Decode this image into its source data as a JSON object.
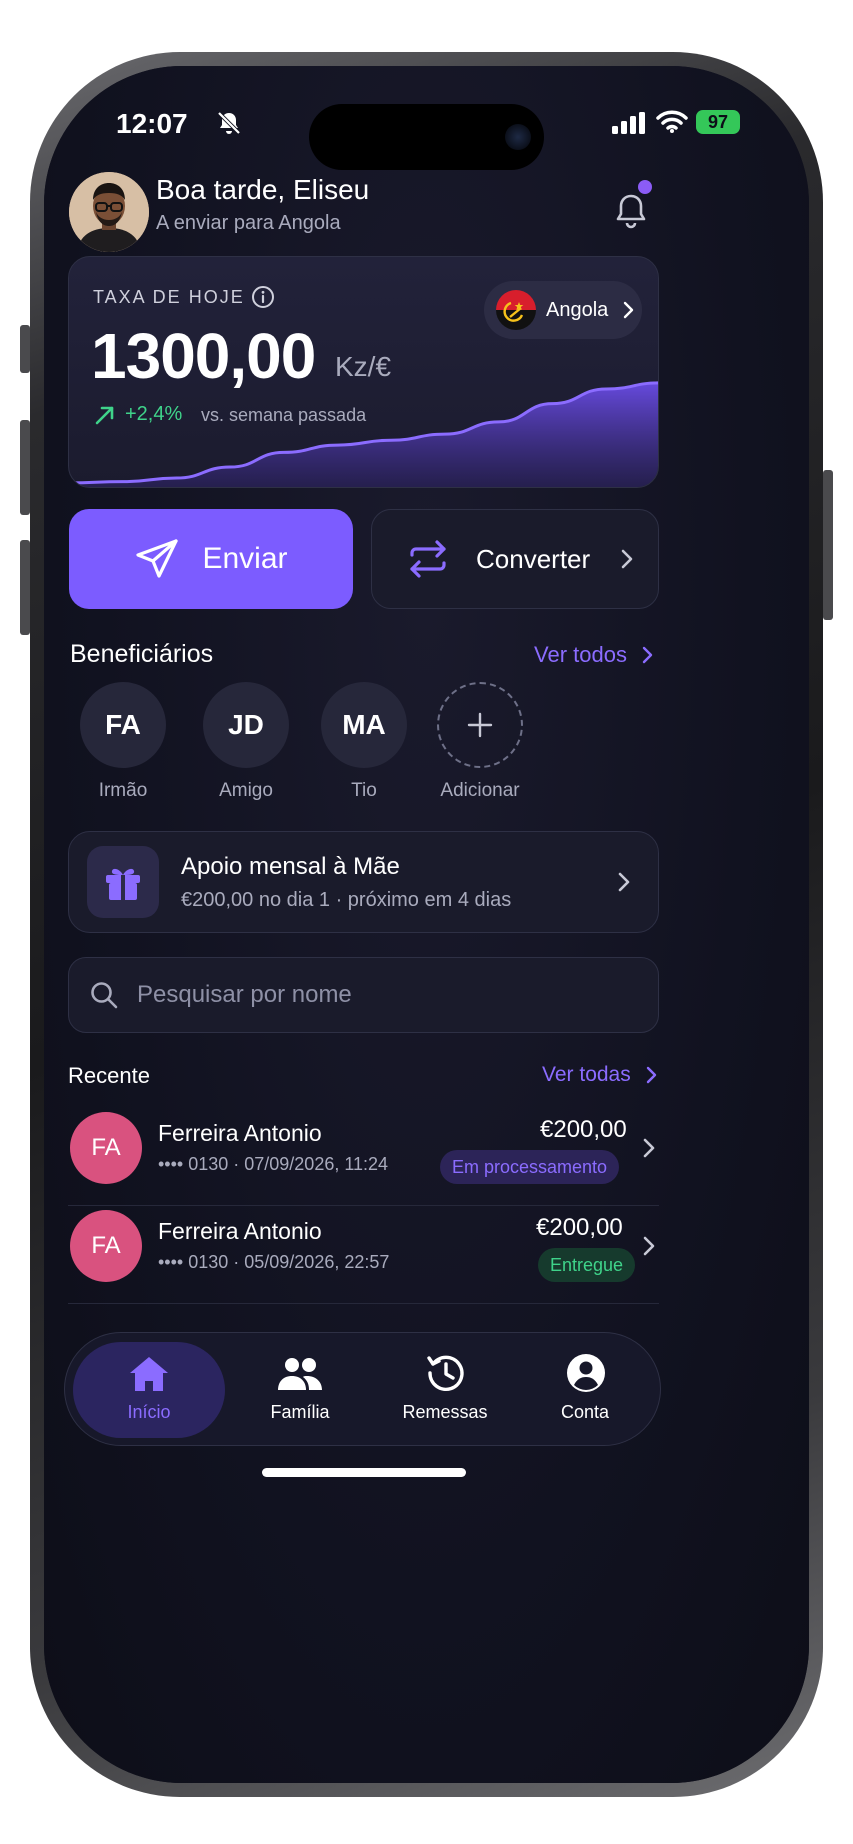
{
  "status_bar": {
    "time": "12:07",
    "battery": "97"
  },
  "header": {
    "greeting": "Boa tarde, Eliseu",
    "subtitle": "A enviar para Angola"
  },
  "rate_card": {
    "label": "TAXA DE HOJE",
    "value": "1300,00",
    "unit": "Kz/€",
    "change": "+2,4%",
    "change_caption": "vs. semana passada",
    "country": "Angola",
    "trend": [
      0.05,
      0.06,
      0.09,
      0.18,
      0.3,
      0.36,
      0.4,
      0.45,
      0.55,
      0.7,
      0.82,
      0.87
    ]
  },
  "actions": {
    "send_label": "Enviar",
    "convert_label": "Converter"
  },
  "beneficiaries": {
    "title": "Beneficiários",
    "view_all": "Ver todos",
    "items": [
      {
        "initials": "FA",
        "label": "Irmão"
      },
      {
        "initials": "JD",
        "label": "Amigo"
      },
      {
        "initials": "MA",
        "label": "Tio"
      }
    ],
    "add_label": "Adicionar"
  },
  "recurring": {
    "title": "Apoio mensal à Mãe",
    "subtitle": "€200,00 no dia 1 · próximo em 4 dias"
  },
  "search": {
    "placeholder": "Pesquisar por nome"
  },
  "recent": {
    "title": "Recente",
    "view_all": "Ver todas",
    "items": [
      {
        "initials": "FA",
        "name": "Ferreira Antonio",
        "meta": "•••• 0130 · 07/09/2026, 11:24",
        "amount": "€200,00",
        "status": "Em processamento",
        "status_color": "#8b6cff",
        "status_bg": "#2c2458"
      },
      {
        "initials": "FA",
        "name": "Ferreira Antonio",
        "meta": "•••• 0130 · 05/09/2026, 22:57",
        "amount": "€200,00",
        "status": "Entregue",
        "status_color": "#3fd38a",
        "status_bg": "#163a2d"
      }
    ]
  },
  "nav": {
    "home": "Início",
    "family": "Família",
    "remittances": "Remessas",
    "account": "Conta"
  },
  "colors": {
    "accent": "#7c5cff",
    "positive": "#3fd38a",
    "avatar_pink": "#d9527f"
  }
}
